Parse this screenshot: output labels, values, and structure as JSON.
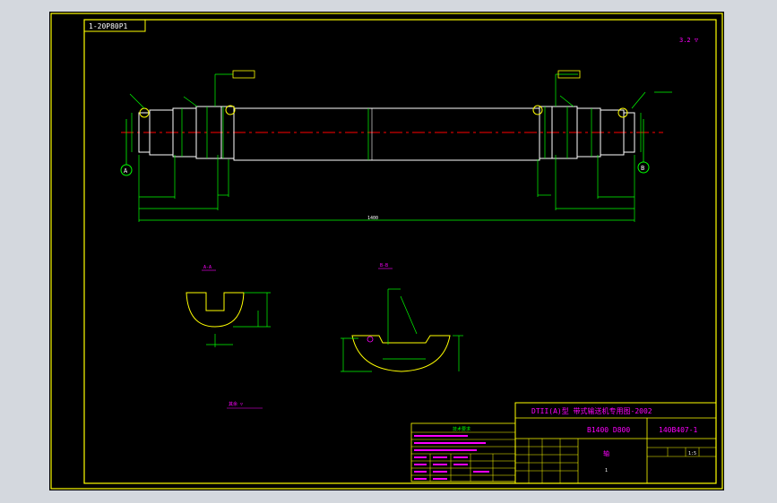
{
  "drawing": {
    "code_box": "1-20P80P1",
    "top_right_note": "3.2 ▽",
    "section_a_label": "A",
    "section_b_label": "B",
    "section_a_title": "A-A",
    "section_b_title": "B-B",
    "note_block": "技术要求",
    "center_dims": [
      "1400"
    ],
    "roughness_note": "其余 ▽"
  },
  "title_block": {
    "header": "DTII(A)型 带式输送机专用图-2002",
    "model": "B1400 D800",
    "drawing_no": "140B407-1",
    "part_name": "轴",
    "scale": "1:5",
    "sheet": "1"
  },
  "colors": {
    "background": "#000000",
    "frame": "#ffff00",
    "outline": "#ffffff",
    "dimension": "#00ff00",
    "center_line": "#ff0000",
    "annotation": "#ff00ff",
    "ui_gray": "#d4d8de"
  }
}
